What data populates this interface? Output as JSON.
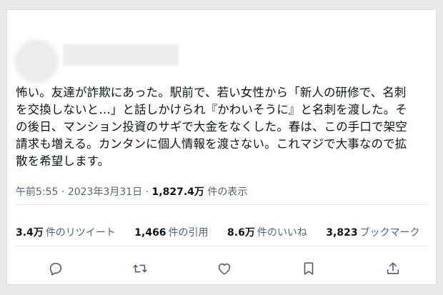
{
  "tweet": {
    "body_lines": [
      "怖い。友達が詐欺にあった。駅前で、若い女性から「新人の研修で、名刺",
      "を交換しないと…」と話しかけられ『かわいそうに』と名刺を渡した。そ",
      "の後日、マンション投資のサギで大金をなくした。春は、この手口で架空",
      "請求も増える。カンタンに個人情報を渡さない。これマジで大事なので拡",
      "散を希望します。"
    ],
    "time": "午前5:55",
    "date": "2023年3月31日",
    "views_count": "1,827.4万",
    "views_label": "件の表示"
  },
  "stats": {
    "retweets_count": "3.4万",
    "retweets_label": "件のリツイート",
    "quotes_count": "1,466",
    "quotes_label": "件の引用",
    "likes_count": "8.6万",
    "likes_label": "件のいいね",
    "bookmarks_count": "3,823",
    "bookmarks_label": "ブックマーク"
  },
  "icons": {
    "reply": "reply-icon",
    "retweet": "retweet-icon",
    "like": "heart-icon",
    "bookmark": "bookmark-icon",
    "share": "share-icon"
  },
  "colors": {
    "text": "#0f1419",
    "secondary": "#536471",
    "divider": "#e7e9ea"
  }
}
